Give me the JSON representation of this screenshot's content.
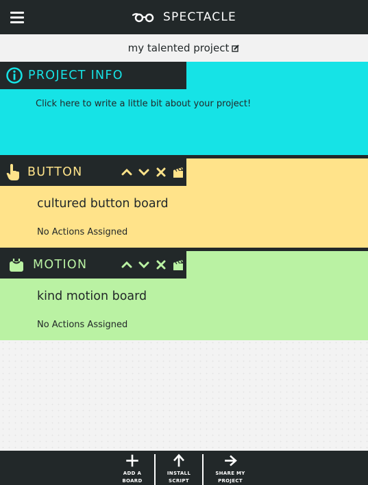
{
  "app": {
    "name": "SPECTACLE"
  },
  "topbar": {
    "menu_icon": "hamburger-icon",
    "logo_icon": "glasses-icon"
  },
  "project": {
    "title": "my talented project",
    "edit_icon": "edit-icon"
  },
  "project_info": {
    "title": "PROJECT INFO",
    "icon": "info-icon",
    "placeholder": "Click here to write a little bit about your project!",
    "color": "#16e3e6"
  },
  "boards": [
    {
      "type": "BUTTON",
      "icon": "hand-pointer-icon",
      "name": "cultured button board",
      "actions": "No Actions Assigned",
      "color": "#ffe38a"
    },
    {
      "type": "MOTION",
      "icon": "motion-sensor-icon",
      "name": "kind motion board",
      "actions": "No Actions Assigned",
      "color": "#baf2a3"
    }
  ],
  "board_controls": [
    "move-up-icon",
    "move-down-icon",
    "delete-icon",
    "clapperboard-icon"
  ],
  "bottombar": {
    "add_board": "ADD A\nBOARD",
    "install_script": "INSTALL\nSCRIPT",
    "share_project": "SHARE MY\nPROJECT"
  },
  "colors": {
    "dark": "#222829"
  }
}
